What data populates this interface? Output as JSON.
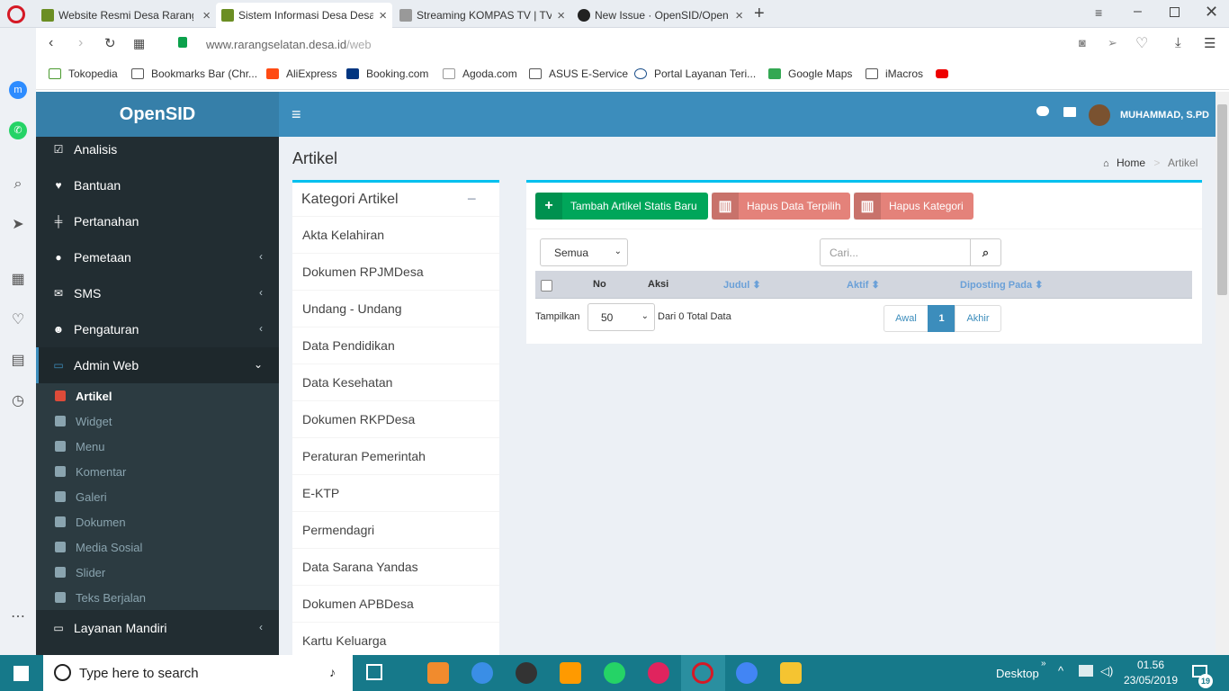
{
  "browser": {
    "tabs": [
      {
        "title": "Website Resmi Desa Rarang"
      },
      {
        "title": "Sistem Informasi Desa Desa"
      },
      {
        "title": "Streaming KOMPAS TV | TV"
      },
      {
        "title": "New Issue · OpenSID/Open"
      }
    ],
    "url_host": "www.rarangselatan.desa.id",
    "url_path": "/web",
    "bookmarks": [
      "Tokopedia",
      "Bookmarks Bar (Chr...",
      "AliExpress",
      "Booking.com",
      "Agoda.com",
      "ASUS E-Service",
      "Portal Layanan Teri...",
      "Google Maps",
      "iMacros"
    ]
  },
  "app": {
    "brand": "OpenSID",
    "user_name": "MUHAMMAD, S.PD",
    "menu": [
      {
        "label": "Analisis",
        "icon": "check-square-icon",
        "has_chevron": false
      },
      {
        "label": "Bantuan",
        "icon": "heart-icon",
        "has_chevron": false
      },
      {
        "label": "Pertanahan",
        "icon": "signpost-icon",
        "has_chevron": false
      },
      {
        "label": "Pemetaan",
        "icon": "globe-icon",
        "has_chevron": true
      },
      {
        "label": "SMS",
        "icon": "envelope-icon",
        "has_chevron": true
      },
      {
        "label": "Pengaturan",
        "icon": "users-icon",
        "has_chevron": true
      },
      {
        "label": "Admin Web",
        "icon": "desktop-icon",
        "has_chevron": true
      }
    ],
    "submenu": [
      "Artikel",
      "Widget",
      "Menu",
      "Komentar",
      "Galeri",
      "Dokumen",
      "Media Sosial",
      "Slider",
      "Teks Berjalan"
    ],
    "menu_bottom": {
      "label": "Layanan Mandiri"
    }
  },
  "page": {
    "title": "Artikel",
    "breadcrumb_home": "Home",
    "breadcrumb_sep": ">",
    "breadcrumb_current": "Artikel"
  },
  "kategori": {
    "title": "Kategori Artikel",
    "collapse_symbol": "−",
    "items": [
      "Akta Kelahiran",
      "Dokumen RPJMDesa",
      "Undang - Undang",
      "Data Pendidikan",
      "Data Kesehatan",
      "Dokumen RKPDesa",
      "Peraturan Pemerintah",
      "E-KTP",
      "Permendagri",
      "Data Sarana Yandas",
      "Dokumen APBDesa",
      "Kartu Keluarga"
    ]
  },
  "toolbar": {
    "add_label": "Tambah Artikel Statis Baru",
    "delete_selected_label": "Hapus Data Terpilih",
    "delete_category_label": "Hapus Kategori"
  },
  "filter": {
    "status_value": "Semua",
    "search_placeholder": "Cari..."
  },
  "table": {
    "headers": [
      "No",
      "Aksi",
      "Judul",
      "Aktif",
      "Diposting Pada"
    ],
    "sort_arrow": "⬍"
  },
  "pager": {
    "show_label": "Tampilkan",
    "per_page": "50",
    "total_text": "Dari 0 Total Data",
    "first": "Awal",
    "current": "1",
    "last": "Akhir"
  },
  "taskbar": {
    "search_placeholder": "Type here to search",
    "desktop_label": "Desktop",
    "time": "01.56",
    "date": "23/05/2019",
    "notifications": "19"
  },
  "colors": {
    "header": "#3c8dbc",
    "logo": "#367fa9",
    "sidebar": "#222d32",
    "success": "#00a65a",
    "danger": "#dd4b39",
    "primary": "#3c8dbc"
  }
}
